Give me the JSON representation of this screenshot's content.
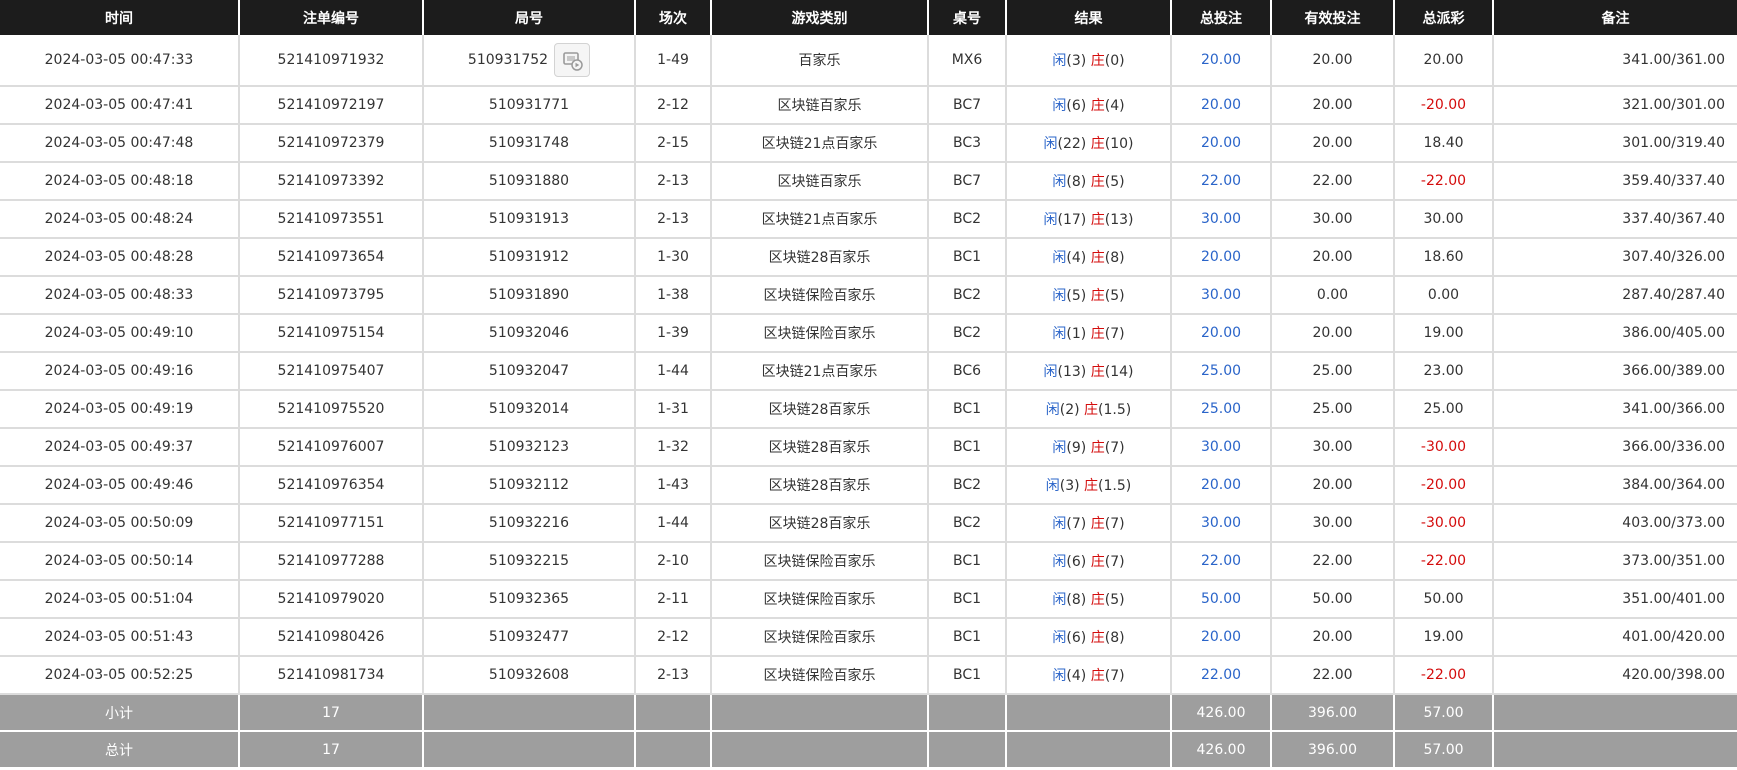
{
  "headers": {
    "time": "时间",
    "order_no": "注单编号",
    "round_no": "局号",
    "session": "场次",
    "game_type": "游戏类别",
    "table_no": "桌号",
    "result": "结果",
    "total_bet": "总投注",
    "valid_bet": "有效投注",
    "total_payout": "总派彩",
    "note": "备注"
  },
  "labels": {
    "player": "闲",
    "banker": "庄"
  },
  "colors": {
    "header_bg": "#1c1c1c",
    "summary_bg": "#9e9e9e",
    "blue": "#2a64c9",
    "red": "#d40c0c"
  },
  "rows": [
    {
      "time": "2024-03-05 00:47:33",
      "order": "521410971932",
      "round": "510931752",
      "session": "1-49",
      "game": "百家乐",
      "table": "MX6",
      "p": "3",
      "b": "0",
      "total": "20.00",
      "valid": "20.00",
      "payout": "20.00",
      "payout_negative": false,
      "note": "341.00/361.00",
      "has_video_icon": true
    },
    {
      "time": "2024-03-05 00:47:41",
      "order": "521410972197",
      "round": "510931771",
      "session": "2-12",
      "game": "区块链百家乐",
      "table": "BC7",
      "p": "6",
      "b": "4",
      "total": "20.00",
      "valid": "20.00",
      "payout": "-20.00",
      "payout_negative": true,
      "note": "321.00/301.00"
    },
    {
      "time": "2024-03-05 00:47:48",
      "order": "521410972379",
      "round": "510931748",
      "session": "2-15",
      "game": "区块链21点百家乐",
      "table": "BC3",
      "p": "22",
      "b": "10",
      "total": "20.00",
      "valid": "20.00",
      "payout": "18.40",
      "payout_negative": false,
      "note": "301.00/319.40"
    },
    {
      "time": "2024-03-05 00:48:18",
      "order": "521410973392",
      "round": "510931880",
      "session": "2-13",
      "game": "区块链百家乐",
      "table": "BC7",
      "p": "8",
      "b": "5",
      "total": "22.00",
      "valid": "22.00",
      "payout": "-22.00",
      "payout_negative": true,
      "note": "359.40/337.40"
    },
    {
      "time": "2024-03-05 00:48:24",
      "order": "521410973551",
      "round": "510931913",
      "session": "2-13",
      "game": "区块链21点百家乐",
      "table": "BC2",
      "p": "17",
      "b": "13",
      "total": "30.00",
      "valid": "30.00",
      "payout": "30.00",
      "payout_negative": false,
      "note": "337.40/367.40"
    },
    {
      "time": "2024-03-05 00:48:28",
      "order": "521410973654",
      "round": "510931912",
      "session": "1-30",
      "game": "区块链28百家乐",
      "table": "BC1",
      "p": "4",
      "b": "8",
      "total": "20.00",
      "valid": "20.00",
      "payout": "18.60",
      "payout_negative": false,
      "note": "307.40/326.00"
    },
    {
      "time": "2024-03-05 00:48:33",
      "order": "521410973795",
      "round": "510931890",
      "session": "1-38",
      "game": "区块链保险百家乐",
      "table": "BC2",
      "p": "5",
      "b": "5",
      "total": "30.00",
      "valid": "0.00",
      "payout": "0.00",
      "payout_negative": false,
      "note": "287.40/287.40"
    },
    {
      "time": "2024-03-05 00:49:10",
      "order": "521410975154",
      "round": "510932046",
      "session": "1-39",
      "game": "区块链保险百家乐",
      "table": "BC2",
      "p": "1",
      "b": "7",
      "total": "20.00",
      "valid": "20.00",
      "payout": "19.00",
      "payout_negative": false,
      "note": "386.00/405.00"
    },
    {
      "time": "2024-03-05 00:49:16",
      "order": "521410975407",
      "round": "510932047",
      "session": "1-44",
      "game": "区块链21点百家乐",
      "table": "BC6",
      "p": "13",
      "b": "14",
      "total": "25.00",
      "valid": "25.00",
      "payout": "23.00",
      "payout_negative": false,
      "note": "366.00/389.00"
    },
    {
      "time": "2024-03-05 00:49:19",
      "order": "521410975520",
      "round": "510932014",
      "session": "1-31",
      "game": "区块链28百家乐",
      "table": "BC1",
      "p": "2",
      "b": "1.5",
      "total": "25.00",
      "valid": "25.00",
      "payout": "25.00",
      "payout_negative": false,
      "note": "341.00/366.00"
    },
    {
      "time": "2024-03-05 00:49:37",
      "order": "521410976007",
      "round": "510932123",
      "session": "1-32",
      "game": "区块链28百家乐",
      "table": "BC1",
      "p": "9",
      "b": "7",
      "total": "30.00",
      "valid": "30.00",
      "payout": "-30.00",
      "payout_negative": true,
      "note": "366.00/336.00"
    },
    {
      "time": "2024-03-05 00:49:46",
      "order": "521410976354",
      "round": "510932112",
      "session": "1-43",
      "game": "区块链28百家乐",
      "table": "BC2",
      "p": "3",
      "b": "1.5",
      "total": "20.00",
      "valid": "20.00",
      "payout": "-20.00",
      "payout_negative": true,
      "note": "384.00/364.00"
    },
    {
      "time": "2024-03-05 00:50:09",
      "order": "521410977151",
      "round": "510932216",
      "session": "1-44",
      "game": "区块链28百家乐",
      "table": "BC2",
      "p": "7",
      "b": "7",
      "total": "30.00",
      "valid": "30.00",
      "payout": "-30.00",
      "payout_negative": true,
      "note": "403.00/373.00"
    },
    {
      "time": "2024-03-05 00:50:14",
      "order": "521410977288",
      "round": "510932215",
      "session": "2-10",
      "game": "区块链保险百家乐",
      "table": "BC1",
      "p": "6",
      "b": "7",
      "total": "22.00",
      "valid": "22.00",
      "payout": "-22.00",
      "payout_negative": true,
      "note": "373.00/351.00"
    },
    {
      "time": "2024-03-05 00:51:04",
      "order": "521410979020",
      "round": "510932365",
      "session": "2-11",
      "game": "区块链保险百家乐",
      "table": "BC1",
      "p": "8",
      "b": "5",
      "total": "50.00",
      "valid": "50.00",
      "payout": "50.00",
      "payout_negative": false,
      "note": "351.00/401.00"
    },
    {
      "time": "2024-03-05 00:51:43",
      "order": "521410980426",
      "round": "510932477",
      "session": "2-12",
      "game": "区块链保险百家乐",
      "table": "BC1",
      "p": "6",
      "b": "8",
      "total": "20.00",
      "valid": "20.00",
      "payout": "19.00",
      "payout_negative": false,
      "note": "401.00/420.00"
    },
    {
      "time": "2024-03-05 00:52:25",
      "order": "521410981734",
      "round": "510932608",
      "session": "2-13",
      "game": "区块链保险百家乐",
      "table": "BC1",
      "p": "4",
      "b": "7",
      "total": "22.00",
      "valid": "22.00",
      "payout": "-22.00",
      "payout_negative": true,
      "note": "420.00/398.00"
    }
  ],
  "subtotal": {
    "label": "小计",
    "count": "17",
    "total": "426.00",
    "valid": "396.00",
    "payout": "57.00"
  },
  "grand_total": {
    "label": "总计",
    "count": "17",
    "total": "426.00",
    "valid": "396.00",
    "payout": "57.00"
  }
}
